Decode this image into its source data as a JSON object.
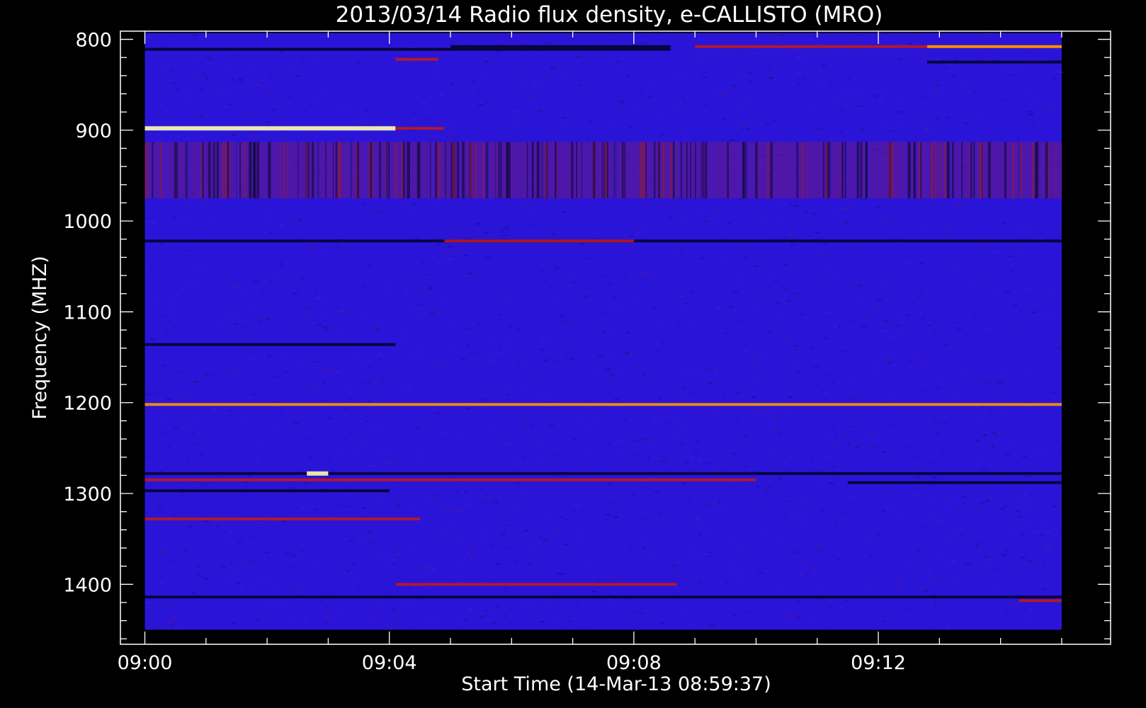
{
  "chart_data": {
    "type": "heatmap",
    "title": "2013/03/14  Radio flux density, e-CALLISTO (MRO)",
    "xlabel": "Start Time (14-Mar-13 08:59:37)",
    "ylabel": "Frequency (MHZ)",
    "x_unit": "minutes after 09:00",
    "xlim": [
      -0.4,
      15.8
    ],
    "ylim": [
      1466,
      791
    ],
    "data_x_range": [
      0,
      15.0
    ],
    "data_y_range": [
      793,
      1450
    ],
    "x_ticks": [
      {
        "value": 0,
        "label": "09:00"
      },
      {
        "value": 4,
        "label": "09:04"
      },
      {
        "value": 8,
        "label": "09:08"
      },
      {
        "value": 12,
        "label": "09:12"
      }
    ],
    "y_ticks": [
      {
        "value": 800,
        "label": "800"
      },
      {
        "value": 900,
        "label": "900"
      },
      {
        "value": 1000,
        "label": "1000"
      },
      {
        "value": 1100,
        "label": "1100"
      },
      {
        "value": 1200,
        "label": "1200"
      },
      {
        "value": 1300,
        "label": "1300"
      },
      {
        "value": 1400,
        "label": "1400"
      }
    ],
    "background_color": "#2a14d8",
    "colors": {
      "low": "#000018",
      "mid": "#2a14d8",
      "elevated": "#7a1a70",
      "high": "#c01818",
      "peak": "#ff9a00",
      "max": "#ffffb0"
    },
    "features": [
      {
        "kind": "band",
        "level": "low",
        "freq": 811,
        "t_start": 0.0,
        "t_end": 8.6
      },
      {
        "kind": "band",
        "level": "low",
        "freq": 808,
        "t_start": 5.0,
        "t_end": 8.6
      },
      {
        "kind": "band",
        "level": "high",
        "freq": 808,
        "t_start": 9.0,
        "t_end": 15.0
      },
      {
        "kind": "band",
        "level": "peak",
        "freq": 808,
        "t_start": 12.8,
        "t_end": 15.0
      },
      {
        "kind": "band",
        "level": "low",
        "freq": 825,
        "t_start": 12.8,
        "t_end": 15.0
      },
      {
        "kind": "band",
        "level": "high",
        "freq": 822,
        "t_start": 4.1,
        "t_end": 4.8
      },
      {
        "kind": "band",
        "level": "max",
        "freq": 898,
        "t_start": 0.0,
        "t_end": 4.1
      },
      {
        "kind": "band",
        "level": "high",
        "freq": 898,
        "t_start": 4.1,
        "t_end": 4.9
      },
      {
        "kind": "region",
        "level": "elevated",
        "freq_start": 913,
        "freq_end": 975,
        "t_start": 0.0,
        "t_end": 15.0
      },
      {
        "kind": "band",
        "level": "low",
        "freq": 1022,
        "t_start": 0.0,
        "t_end": 15.0
      },
      {
        "kind": "band",
        "level": "high",
        "freq": 1022,
        "t_start": 4.9,
        "t_end": 8.0
      },
      {
        "kind": "band",
        "level": "low",
        "freq": 1136,
        "t_start": 0.0,
        "t_end": 4.1
      },
      {
        "kind": "band",
        "level": "peak",
        "freq": 1202,
        "t_start": 0.0,
        "t_end": 15.0
      },
      {
        "kind": "band",
        "level": "low",
        "freq": 1278,
        "t_start": 0.0,
        "t_end": 15.0
      },
      {
        "kind": "band",
        "level": "high",
        "freq": 1285,
        "t_start": 0.0,
        "t_end": 10.0
      },
      {
        "kind": "band",
        "level": "low",
        "freq": 1297,
        "t_start": 0.0,
        "t_end": 4.0
      },
      {
        "kind": "band",
        "level": "low",
        "freq": 1288,
        "t_start": 11.5,
        "t_end": 15.0
      },
      {
        "kind": "band",
        "level": "max",
        "freq": 1278,
        "t_start": 2.65,
        "t_end": 3.0
      },
      {
        "kind": "band",
        "level": "high",
        "freq": 1328,
        "t_start": 0.0,
        "t_end": 4.5
      },
      {
        "kind": "band",
        "level": "high",
        "freq": 1400,
        "t_start": 4.1,
        "t_end": 8.7
      },
      {
        "kind": "band",
        "level": "low",
        "freq": 1414,
        "t_start": 0.0,
        "t_end": 15.0
      },
      {
        "kind": "band",
        "level": "high",
        "freq": 1418,
        "t_start": 14.3,
        "t_end": 15.0
      }
    ]
  }
}
